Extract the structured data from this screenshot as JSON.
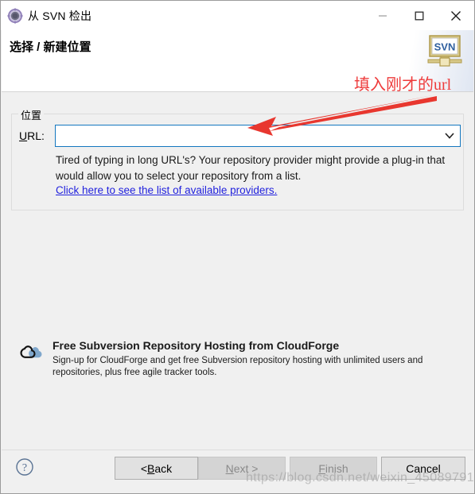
{
  "window": {
    "title": "从 SVN 检出",
    "icon": "svn-gear-icon",
    "controls": {
      "minimize": "minimize-icon",
      "maximize": "maximize-icon",
      "close": "close-icon"
    }
  },
  "header": {
    "title": "选择 / 新建位置",
    "banner_logo_text": "SVN"
  },
  "annotation": {
    "text": "填入刚才的url",
    "color": "#ee3b3b",
    "arrow": "red-arrow-pointing-to-url-field"
  },
  "location_group": {
    "label": "位置",
    "url_label_prefix": "U",
    "url_label_suffix": "RL:",
    "url_value": "",
    "url_placeholder": "",
    "dropdown_icon": "chevron-down-icon",
    "hint_text": "Tired of typing in long URL's?  Your repository provider might provide a plug-in that would allow you to select your repository from a list.",
    "link_text": "Click here to see the list of available providers."
  },
  "cloudforge": {
    "logo": "cloudforge-cloud-icon",
    "title": "Free Subversion Repository Hosting from CloudForge",
    "description": "Sign-up for CloudForge and get free Subversion repository hosting with unlimited users and repositories, plus free agile tracker tools."
  },
  "footer": {
    "help_icon": "help-question-icon",
    "buttons": [
      {
        "id": "back",
        "prefix": "< ",
        "mnemonic": "B",
        "suffix": "ack",
        "disabled": false
      },
      {
        "id": "next",
        "prefix": "",
        "mnemonic": "N",
        "suffix": "ext >",
        "disabled": true
      },
      {
        "id": "finish",
        "prefix": "",
        "mnemonic": "F",
        "suffix": "inish",
        "disabled": true
      },
      {
        "id": "cancel",
        "prefix": "",
        "mnemonic": "",
        "suffix": "Cancel",
        "disabled": false
      }
    ]
  },
  "watermark": {
    "text": "https://blog.csdn.net/weixin_45089791"
  }
}
